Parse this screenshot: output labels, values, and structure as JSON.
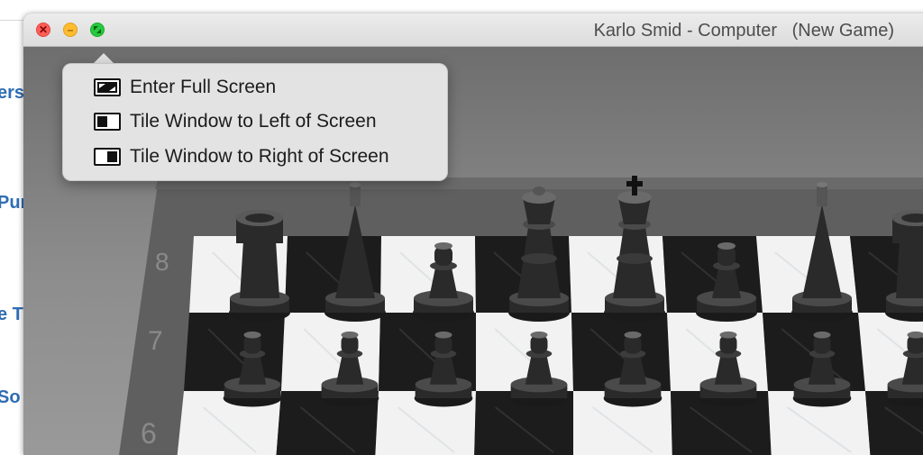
{
  "background_app": {
    "fragments": [
      "erst",
      "Pur",
      "e T",
      "So"
    ]
  },
  "window": {
    "title": "Karlo Smid - Computer   (New Game)",
    "controls": {
      "close_icon": "close-icon",
      "minimize_icon": "minimize-icon",
      "zoom_icon": "fullscreen-arrows-icon",
      "close_symbol": "✕",
      "minimize_symbol": "–"
    }
  },
  "zoom_menu": {
    "items": [
      {
        "label": "Enter Full Screen",
        "icon": "enter-full-screen-icon"
      },
      {
        "label": "Tile Window to Left of Screen",
        "icon": "tile-left-icon"
      },
      {
        "label": "Tile Window to Right of Screen",
        "icon": "tile-right-icon"
      }
    ]
  },
  "board": {
    "rank_labels": [
      "8",
      "7",
      "6"
    ],
    "colors": {
      "light_square": "#f2f2f2",
      "dark_square": "#1c1c1c",
      "frame": "#5f5f5f",
      "pieces": "#2a2a2a"
    },
    "back_rank_pieces": [
      "rook",
      "bishop",
      "pawn",
      "queen",
      "king",
      "pawn",
      "bishop",
      "rook"
    ],
    "pawn_rank_pieces": [
      "pawn",
      "pawn",
      "pawn",
      "pawn",
      "pawn",
      "pawn",
      "pawn",
      "pawn"
    ]
  }
}
